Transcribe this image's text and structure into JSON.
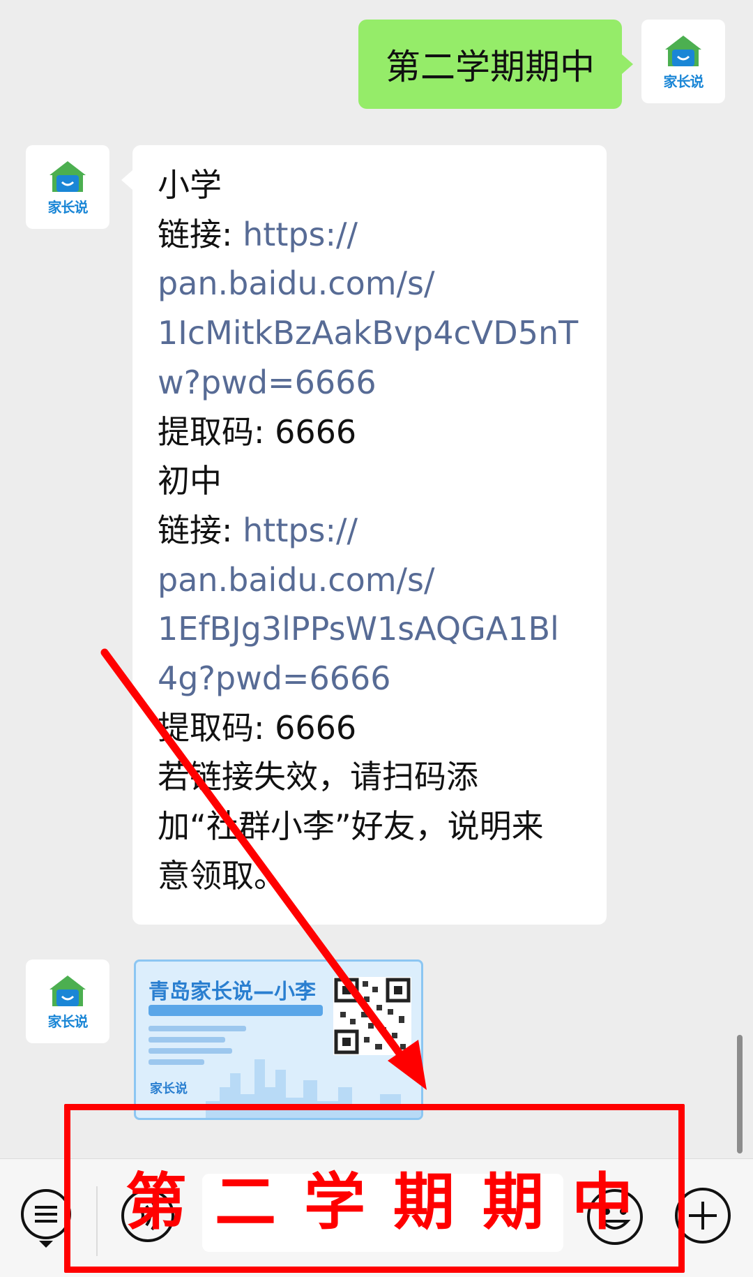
{
  "avatar": {
    "brand": "家长说"
  },
  "messages": {
    "outgoing": "第二学期期中",
    "incoming_lines": [
      {
        "text": "小学",
        "link": false
      },
      {
        "prefix": "链接: ",
        "text": "https://",
        "link": true
      },
      {
        "text": "pan.baidu.com/s/",
        "link": true
      },
      {
        "text": "1IcMitkBzAakBvp4cVD5nT",
        "link": true
      },
      {
        "text": "w?pwd=6666",
        "link": true
      },
      {
        "text": "提取码: 6666",
        "link": false
      },
      {
        "text": "初中",
        "link": false
      },
      {
        "prefix": "链接: ",
        "text": "https://",
        "link": true
      },
      {
        "text": "pan.baidu.com/s/",
        "link": true
      },
      {
        "text": "1EfBJg3lPPsW1sAQGA1Bl",
        "link": true
      },
      {
        "text": "4g?pwd=6666",
        "link": true
      },
      {
        "text": "提取码: 6666",
        "link": false
      },
      {
        "text": "若链接失效，请扫码添",
        "link": false
      },
      {
        "text": "加“社群小李”好友，说明来",
        "link": false
      },
      {
        "text": "意领取。",
        "link": false
      }
    ],
    "qr_card": {
      "title": "青岛家长说—小李",
      "footer": "家长说"
    }
  },
  "annotation": {
    "text": "第二学期期中",
    "color": "#ff0000"
  },
  "toolbar": {
    "icons": [
      "list-icon",
      "voice-icon",
      "emoji-icon",
      "plus-icon"
    ]
  },
  "colors": {
    "outgoing_bubble": "#95ec69",
    "link": "#576b95",
    "background": "#ededed"
  }
}
